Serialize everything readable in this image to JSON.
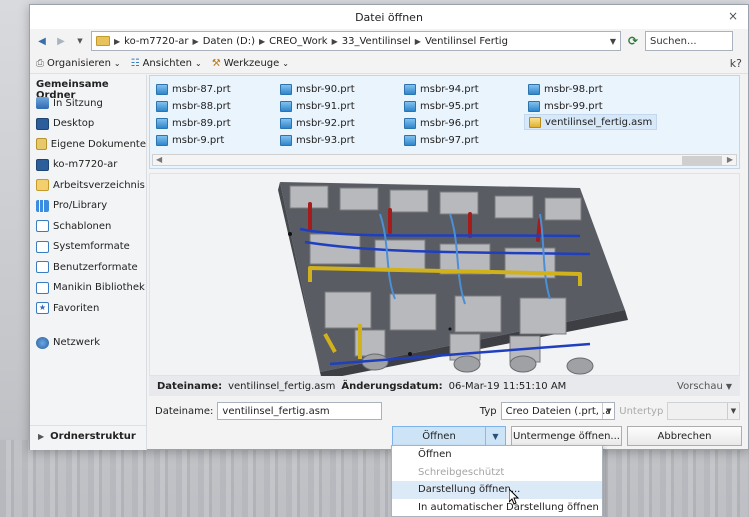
{
  "window": {
    "title": "Datei öffnen",
    "close": "×"
  },
  "address": {
    "crumbs": [
      "ko-m7720-ar",
      "Daten (D:)",
      "CREO_Work",
      "33_Ventilinsel",
      "Ventilinsel Fertig"
    ],
    "search_placeholder": "Suchen..."
  },
  "toolbar": {
    "organize": "Organisieren",
    "views": "Ansichten",
    "tools": "Werkzeuge",
    "help": "k?"
  },
  "sidebar": {
    "header": "Gemeinsame Ordner",
    "items": [
      {
        "label": "In Sitzung",
        "icon": "session-icon"
      },
      {
        "label": "Desktop",
        "icon": "desktop-icon"
      },
      {
        "label": "Eigene Dokumente",
        "icon": "documents-icon"
      },
      {
        "label": "ko-m7720-ar",
        "icon": "computer-icon"
      },
      {
        "label": "Arbeitsverzeichnis",
        "icon": "working-directory-icon"
      },
      {
        "label": "Pro/Library",
        "icon": "library-icon"
      },
      {
        "label": "Schablonen",
        "icon": "folder-icon"
      },
      {
        "label": "Systemformate",
        "icon": "folder-icon"
      },
      {
        "label": "Benutzerformate",
        "icon": "folder-icon"
      },
      {
        "label": "Manikin Bibliothek",
        "icon": "folder-icon"
      },
      {
        "label": "Favoriten",
        "icon": "favorites-icon"
      }
    ],
    "network": "Netzwerk",
    "folder_tree": "Ordnerstruktur"
  },
  "files": [
    "msbr-87.prt",
    "msbr-88.prt",
    "msbr-89.prt",
    "msbr-9.prt",
    "msbr-90.prt",
    "msbr-91.prt",
    "msbr-92.prt",
    "msbr-93.prt",
    "msbr-94.prt",
    "msbr-95.prt",
    "msbr-96.prt",
    "msbr-97.prt",
    "msbr-98.prt",
    "msbr-99.prt",
    "ventilinsel_fertig.asm"
  ],
  "selected_file": "ventilinsel_fertig.asm",
  "info": {
    "name_label": "Dateiname:",
    "name_value": "ventilinsel_fertig.asm",
    "date_label": "Änderungsdatum:",
    "date_value": "06-Mar-19 11:51:10 AM",
    "preview": "Vorschau"
  },
  "filename_row": {
    "label": "Dateiname:",
    "value": "ventilinsel_fertig.asm",
    "type_label": "Typ",
    "type_value": "Creo Dateien (.prt, .asm",
    "subtype_label": "Untertyp"
  },
  "buttons": {
    "open": "Öffnen",
    "subset": "Untermenge öffnen...",
    "cancel": "Abbrechen"
  },
  "open_menu": [
    {
      "label": "Öffnen",
      "enabled": true
    },
    {
      "label": "Schreibgeschützt",
      "enabled": false
    },
    {
      "label": "Darstellung öffnen...",
      "enabled": true,
      "highlighted": true
    },
    {
      "label": "In automatischer Darstellung öffnen",
      "enabled": true
    }
  ]
}
